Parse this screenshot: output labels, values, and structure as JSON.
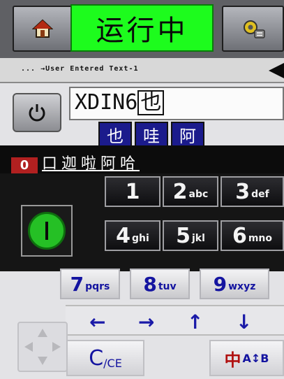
{
  "topbar": {
    "status": "运行中",
    "status_color": "#1dfc1d",
    "home_icon": "home-icon",
    "settings_icon": "settings-gear-icon"
  },
  "message_bar": {
    "text": "... →User Entered Text-1",
    "arrow_icon": "left-triangle-icon"
  },
  "editor": {
    "value": "XDIN6",
    "cursor_char": "也",
    "candidates": [
      "也",
      "哇",
      "阿"
    ],
    "tab_label": "口迦啦阿哈",
    "lock_indicator": "0"
  },
  "keypad": {
    "keys": [
      {
        "digit": "1",
        "letters": ""
      },
      {
        "digit": "2",
        "letters": "abc"
      },
      {
        "digit": "3",
        "letters": "def"
      },
      {
        "digit": "4",
        "letters": "ghi"
      },
      {
        "digit": "5",
        "letters": "jkl"
      },
      {
        "digit": "6",
        "letters": "mno"
      },
      {
        "digit": "7",
        "letters": "pqrs"
      },
      {
        "digit": "8",
        "letters": "tuv"
      },
      {
        "digit": "9",
        "letters": "wxyz"
      }
    ],
    "arrows": [
      "←",
      "→",
      "↑",
      "↓"
    ],
    "clear_label": "C",
    "clear_sub": "/CE",
    "ime_label": "中",
    "ime_sub": "A↕B"
  }
}
